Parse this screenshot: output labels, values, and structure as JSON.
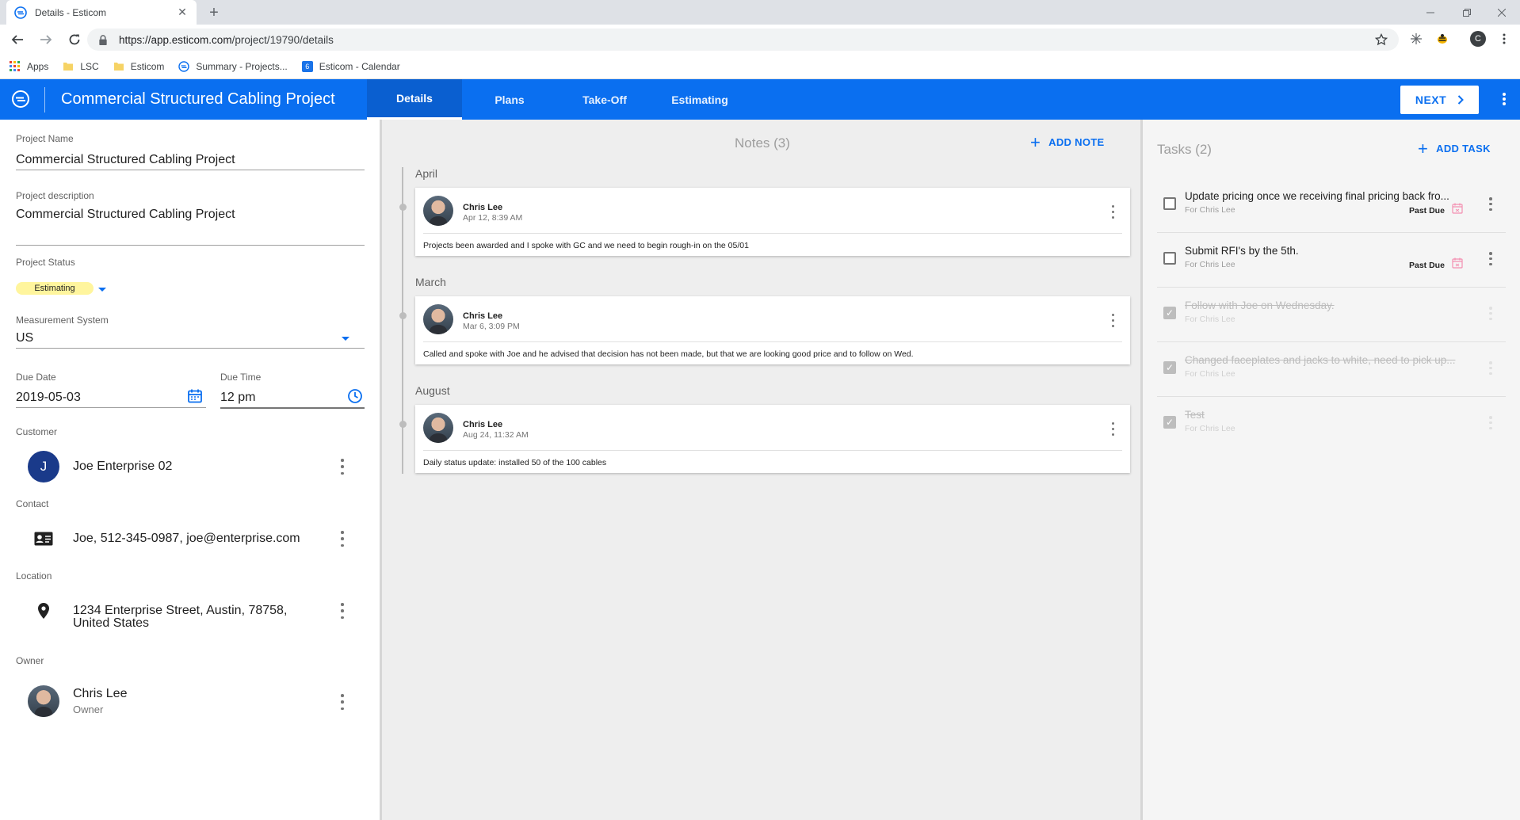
{
  "browser": {
    "tab_title": "Details - Esticom",
    "url_host": "https://app.esticom.com",
    "url_path": "/project/19790/details",
    "profile_initial": "C",
    "bookmarks": [
      {
        "label": "Apps",
        "icon": "apps-grid-icon"
      },
      {
        "label": "LSC",
        "icon": "folder-icon"
      },
      {
        "label": "Esticom",
        "icon": "folder-icon"
      },
      {
        "label": "Summary - Projects...",
        "icon": "esticom-icon"
      },
      {
        "label": "Esticom - Calendar",
        "icon": "calendar-icon"
      }
    ],
    "calendar_icon_text": "6"
  },
  "appbar": {
    "title": "Commercial Structured Cabling Project",
    "tabs": [
      {
        "label": "Details",
        "active": true
      },
      {
        "label": "Plans",
        "active": false
      },
      {
        "label": "Take-Off",
        "active": false
      },
      {
        "label": "Estimating",
        "active": false
      }
    ],
    "next_label": "NEXT"
  },
  "details": {
    "project_name_label": "Project Name",
    "project_name": "Commercial Structured Cabling Project",
    "description_label": "Project description",
    "description": "Commercial Structured Cabling Project",
    "status_label": "Project Status",
    "status": "Estimating",
    "status_color": "#fff59d",
    "measurement_label": "Measurement System",
    "measurement": "US",
    "due_date_label": "Due Date",
    "due_date": "2019-05-03",
    "due_time_label": "Due Time",
    "due_time": "12 pm",
    "customer_label": "Customer",
    "customer_initial": "J",
    "customer": "Joe Enterprise 02",
    "contact_label": "Contact",
    "contact": "Joe, 512-345-0987, joe@enterprise.com",
    "location_label": "Location",
    "location_line1": "1234 Enterprise Street, Austin, 78758,",
    "location_line2": "United States",
    "owner_label": "Owner",
    "owner_name": "Chris Lee",
    "owner_role": "Owner"
  },
  "notes": {
    "title": "Notes (3)",
    "add_label": "ADD NOTE",
    "groups": [
      {
        "month": "April",
        "author": "Chris Lee",
        "time": "Apr 12, 8:39 AM",
        "body": "Projects been awarded and I spoke with GC and we need to begin rough-in on the 05/01"
      },
      {
        "month": "March",
        "author": "Chris Lee",
        "time": "Mar 6, 3:09 PM",
        "body": "Called and spoke with Joe and he advised that decision has not been made, but that we are looking good price and to follow on Wed."
      },
      {
        "month": "August",
        "author": "Chris Lee",
        "time": "Aug 24, 11:32 AM",
        "body": "Daily status update: installed 50 of the 100 cables"
      }
    ]
  },
  "tasks": {
    "title": "Tasks (2)",
    "add_label": "ADD TASK",
    "items": [
      {
        "title": "Update pricing once we receiving final pricing back fro...",
        "for": "For Chris Lee",
        "due": "Past Due",
        "done": false
      },
      {
        "title": "Submit RFI's by the 5th.",
        "for": "For Chris Lee",
        "due": "Past Due",
        "done": false
      },
      {
        "title": "Follow with Joe on Wednesday.",
        "for": "For Chris Lee",
        "due": "",
        "done": true
      },
      {
        "title": "Changed faceplates and jacks to white, need to pick up...",
        "for": "For Chris Lee",
        "due": "",
        "done": true
      },
      {
        "title": "Test",
        "for": "For Chris Lee",
        "due": "",
        "done": true
      }
    ]
  },
  "colors": {
    "brand_blue": "#0a6ff0",
    "past_due_icon": "#f48fb1"
  }
}
